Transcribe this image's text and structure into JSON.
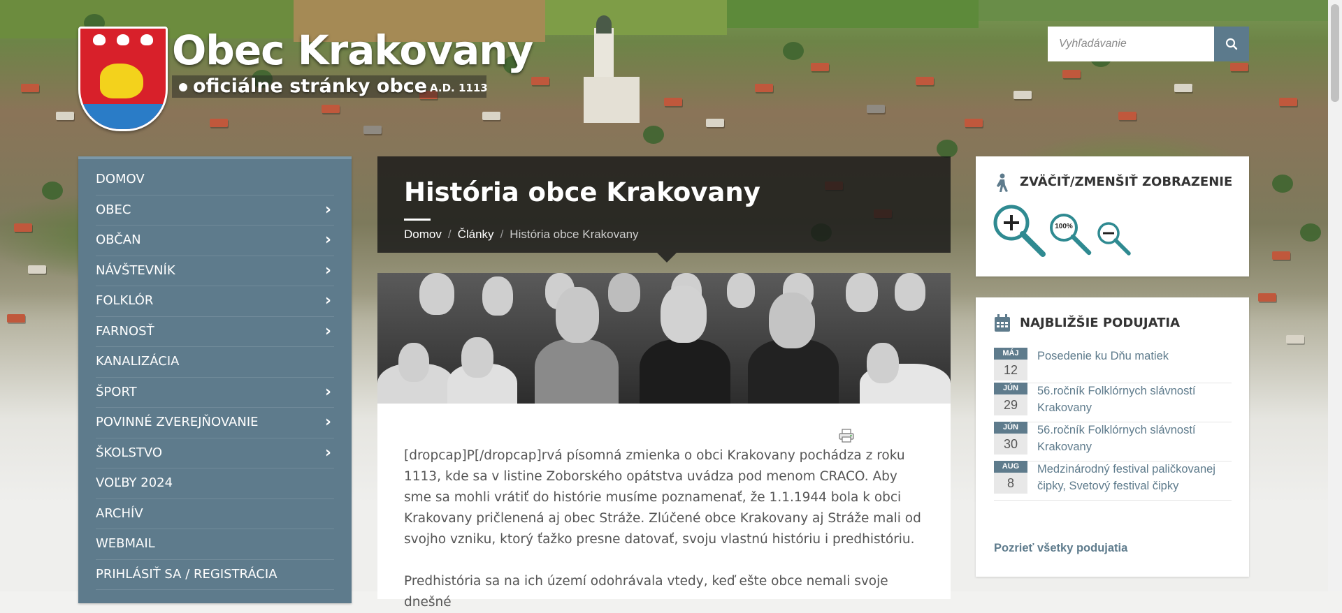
{
  "header": {
    "site_title": "Obec Krakovany",
    "site_subtitle": "oficiálne stránky obce",
    "site_year": "A.D. 1113",
    "search_placeholder": "Vyhľadávanie"
  },
  "nav": {
    "items": [
      {
        "label": "DOMOV",
        "has_submenu": false
      },
      {
        "label": "OBEC",
        "has_submenu": true
      },
      {
        "label": "OBČAN",
        "has_submenu": true
      },
      {
        "label": "NÁVŠTEVNÍK",
        "has_submenu": true
      },
      {
        "label": "FOLKLÓR",
        "has_submenu": true
      },
      {
        "label": "FARNOSŤ",
        "has_submenu": true
      },
      {
        "label": "KANALIZÁCIA",
        "has_submenu": false
      },
      {
        "label": "ŠPORT",
        "has_submenu": true
      },
      {
        "label": "POVINNÉ ZVEREJŇOVANIE",
        "has_submenu": true
      },
      {
        "label": "ŠKOLSTVO",
        "has_submenu": true
      },
      {
        "label": "VOĽBY 2024",
        "has_submenu": false
      },
      {
        "label": "ARCHÍV",
        "has_submenu": false
      },
      {
        "label": "WEBMAIL",
        "has_submenu": false
      },
      {
        "label": "PRIHLÁSIŤ SA / REGISTRÁCIA",
        "has_submenu": false
      }
    ]
  },
  "main": {
    "title": "História obce Krakovany",
    "breadcrumb": [
      "Domov",
      "Články",
      "História obce Krakovany"
    ],
    "paragraphs": [
      "[dropcap]P[/dropcap]rvá písomná zmienka o obci Krakovany pochádza z roku 1113, kde sa v listine Zoborského opátstva uvádza pod menom CRACO. Aby sme sa mohli vrátiť do histórie musíme poznamenať, že 1.1.1944 bola k obci Krakovany pričlenená aj obec Stráže. Zlúčené obce Krakovany aj Stráže mali od svojho vzniku, ktorý ťažko presne datovať, svoju vlastnú históriu i predhistóriu.",
      "Predhistória sa na ich území odohrávala vtedy, keď ešte obce nemali svoje dnešné"
    ]
  },
  "zoom_widget": {
    "title": "ZVÄČIŤ/ZMENŠIŤ ZOBRAZENIE",
    "reset_label": "100%"
  },
  "events_widget": {
    "title": "NAJBLIŽŠIE PODUJATIA",
    "events": [
      {
        "month": "MÁJ",
        "day": "12",
        "title": "Posedenie ku Dňu matiek"
      },
      {
        "month": "JÚN",
        "day": "29",
        "title": "56.ročník Folklórnych slávností Krakovany"
      },
      {
        "month": "JÚN",
        "day": "30",
        "title": "56.ročník Folklórnych slávností Krakovany"
      },
      {
        "month": "AUG",
        "day": "8",
        "title": "Medzinárodný festival paličkovanej čipky, Svetový festival čipky"
      }
    ],
    "all_link": "Pozrieť všetky podujatia"
  },
  "colors": {
    "accent": "#5e7b8c",
    "teal_icon": "#2f8a91",
    "crest_red": "#d8202a"
  }
}
